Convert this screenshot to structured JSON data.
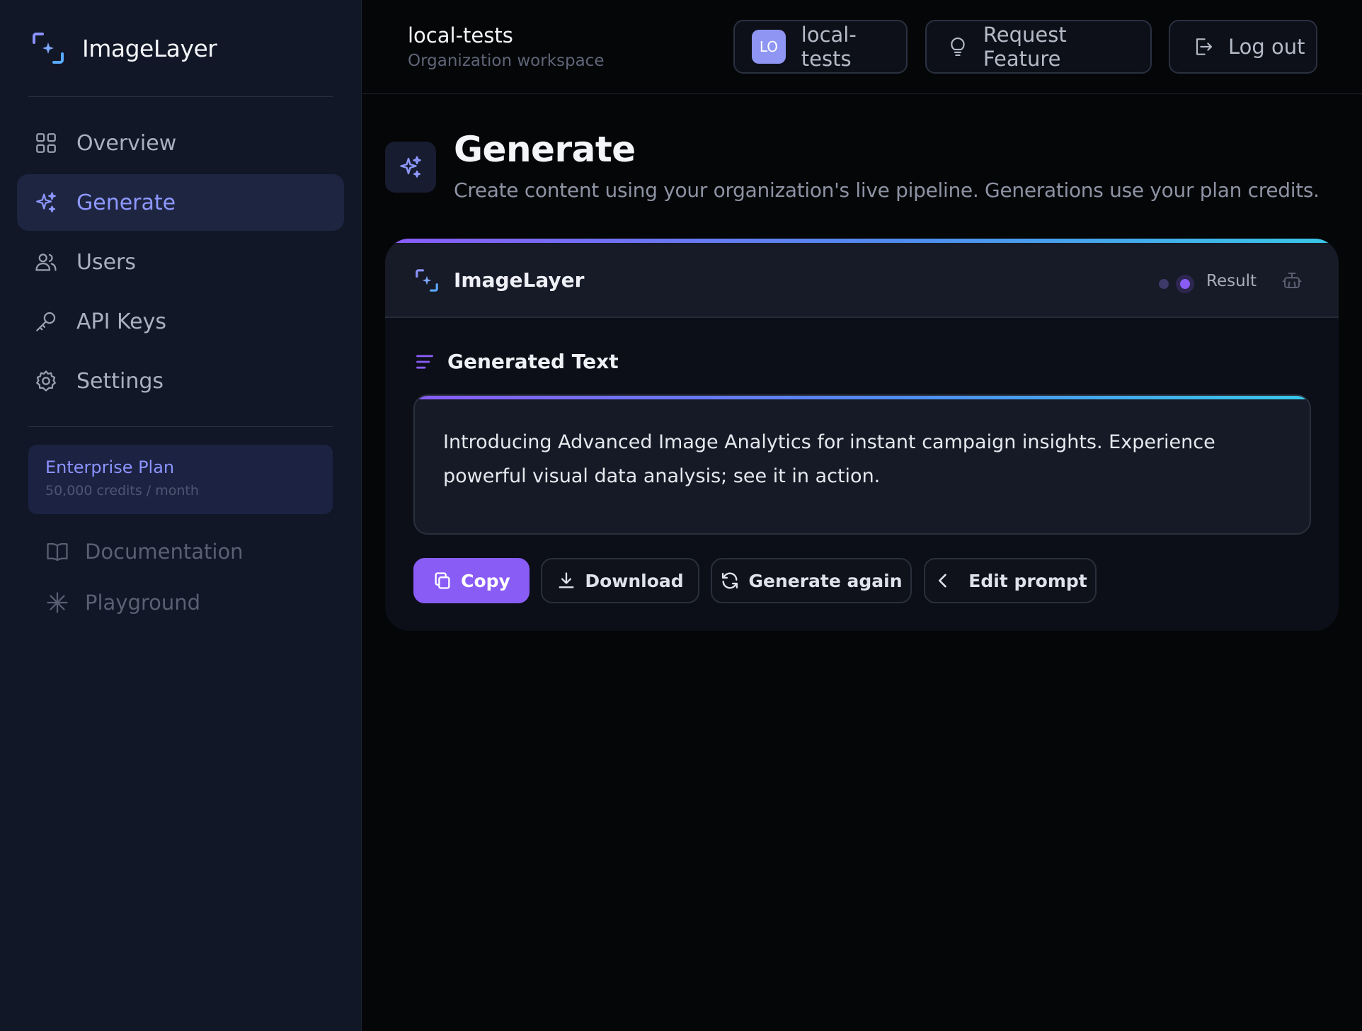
{
  "sidebar": {
    "brand": "ImageLayer",
    "nav": [
      {
        "label": "Overview",
        "icon": "grid-icon",
        "active": false
      },
      {
        "label": "Generate",
        "icon": "sparkles-icon",
        "active": true
      },
      {
        "label": "Users",
        "icon": "users-icon",
        "active": false
      },
      {
        "label": "API Keys",
        "icon": "key-icon",
        "active": false
      },
      {
        "label": "Settings",
        "icon": "gear-icon",
        "active": false
      }
    ],
    "plan": {
      "name": "Enterprise Plan",
      "credits": "50,000 credits / month"
    },
    "secondary": [
      {
        "label": "Documentation",
        "icon": "book-icon"
      },
      {
        "label": "Playground",
        "icon": "asterisk-icon"
      }
    ]
  },
  "header": {
    "workspace_name": "local-tests",
    "workspace_subtitle": "Organization workspace",
    "org_button": {
      "initials": "LO",
      "label": "local-tests"
    },
    "request_feature": "Request Feature",
    "logout": "Log out"
  },
  "main": {
    "title": "Generate",
    "subtitle": "Create content using your organization's live pipeline. Generations use your plan credits.",
    "card": {
      "title": "ImageLayer",
      "status": "Result",
      "section_title": "Generated Text",
      "generated_text": "Introducing Advanced Image Analytics for instant campaign insights. Experience powerful visual data analysis; see it in action.",
      "actions": {
        "copy": "Copy",
        "download": "Download",
        "generate_again": "Generate again",
        "edit_prompt": "Edit prompt"
      }
    }
  },
  "colors": {
    "accent": "#8a5cf6",
    "nav_active_text": "#8e98ff",
    "sidebar_bg": "#111726",
    "page_bg": "#050608"
  }
}
